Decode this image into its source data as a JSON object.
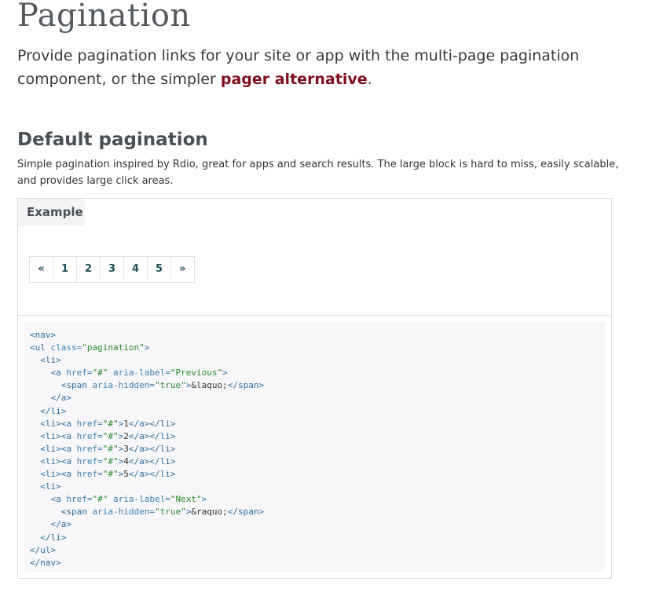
{
  "page": {
    "title": "Pagination",
    "lead_before": "Provide pagination links for your site or app with the multi-page pagination component, or the simpler ",
    "lead_link": "pager alternative",
    "lead_after": "."
  },
  "section": {
    "title": "Default pagination",
    "description": "Simple pagination inspired by Rdio, great for apps and search results. The large block is hard to miss, easily scalable, and provides large click areas."
  },
  "example": {
    "label": "Example",
    "pagination": {
      "previous": "«",
      "pages": [
        "1",
        "2",
        "3",
        "4",
        "5"
      ],
      "next": "»"
    }
  },
  "code": {
    "lines": [
      "<nav>",
      "<ul class=\"pagination\">",
      "  <li>",
      "    <a href=\"#\" aria-label=\"Previous\">",
      "      <span aria-hidden=\"true\">&laquo;</span>",
      "    </a>",
      "  </li>",
      "  <li><a href=\"#\">1</a></li>",
      "  <li><a href=\"#\">2</a></li>",
      "  <li><a href=\"#\">3</a></li>",
      "  <li><a href=\"#\">4</a></li>",
      "  <li><a href=\"#\">5</a></li>",
      "  <li>",
      "    <a href=\"#\" aria-label=\"Next\">",
      "      <span aria-hidden=\"true\">&raquo;</span>",
      "    </a>",
      "  </li>",
      "</ul>",
      "</nav>"
    ]
  },
  "colors": {
    "link": "#7e0f1c",
    "pagination_text": "#1f4e58",
    "code_tag": "#2f6f9f",
    "code_string": "#2c8a2c"
  }
}
